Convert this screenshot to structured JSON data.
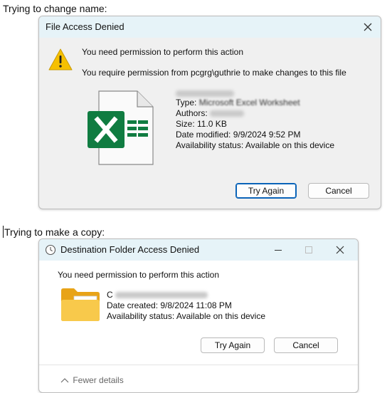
{
  "caption1": "Trying to change name:",
  "caption2": "Trying to make a copy:",
  "dialog1": {
    "title": "File Access Denied",
    "message1": "You need permission to perform this action",
    "message2": "You require permission from pcgrg\\guthrie to make changes to this file",
    "type_label": "Type:",
    "type_value": "Microsoft Excel Worksheet",
    "authors_label": "Authors:",
    "size": "Size: 11.0 KB",
    "date_modified": "Date modified: 9/9/2024 9:52 PM",
    "availability": "Availability status: Available on this device",
    "try_again": "Try Again",
    "cancel": "Cancel"
  },
  "dialog2": {
    "title": "Destination Folder Access Denied",
    "message": "You need permission to perform this action",
    "name_initial": "C",
    "date_created": "Date created: 9/8/2024 11:08 PM",
    "availability": "Availability status: Available on this device",
    "try_again": "Try Again",
    "cancel": "Cancel",
    "fewer_details": "Fewer details"
  },
  "icons": [
    "warning-icon",
    "excel-file-icon",
    "close-icon",
    "clock-icon",
    "minimize-icon",
    "maximize-icon",
    "folder-icon",
    "chevron-up-icon"
  ],
  "colors": {
    "titlebar": "#e6f3f8",
    "dialog_bg": "#f0f0f0",
    "primary_border": "#0a63b8",
    "excel_green": "#107c41",
    "warning_yellow": "#f6c000"
  }
}
